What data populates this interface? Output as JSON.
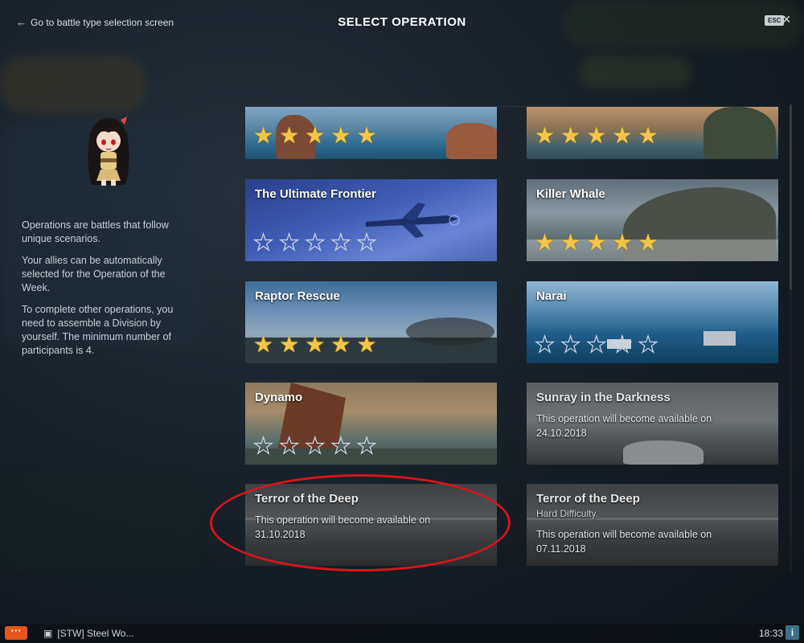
{
  "header": {
    "back_label": "Go to battle type selection screen",
    "title": "SELECT OPERATION",
    "esc_label": "ESC",
    "close_glyph": "×"
  },
  "sidebar": {
    "paragraphs": [
      "Operations are battles that follow unique scenarios.",
      "Your allies can be automatically selected for the Operation of the Week.",
      "To complete other operations, you need to assemble a Division by yourself. The minimum number of participants is 4."
    ]
  },
  "operations": [
    {
      "title": "",
      "stars_earned": 5,
      "stars_total": 5,
      "available": true
    },
    {
      "title": "",
      "stars_earned": 5,
      "stars_total": 5,
      "available": true
    },
    {
      "title": "The Ultimate Frontier",
      "stars_earned": 0,
      "stars_total": 5,
      "available": true
    },
    {
      "title": "Killer Whale",
      "stars_earned": 5,
      "stars_total": 5,
      "available": true
    },
    {
      "title": "Raptor Rescue",
      "stars_earned": 5,
      "stars_total": 5,
      "available": true
    },
    {
      "title": "Narai",
      "stars_earned": 0,
      "stars_total": 5,
      "available": true
    },
    {
      "title": "Dynamo",
      "stars_earned": 0,
      "stars_total": 5,
      "available": true
    },
    {
      "title": "Sunray in the Darkness",
      "available": false,
      "availability_text": "This operation will become available on",
      "availability_date": "24.10.2018"
    },
    {
      "title": "Terror of the Deep",
      "available": false,
      "availability_text": "This operation will become available on",
      "availability_date": "31.10.2018"
    },
    {
      "title": "Terror of the Deep",
      "subtitle": "Hard Difficulty.",
      "available": false,
      "availability_text": "This operation will become available on",
      "availability_date": "07.11.2018"
    }
  ],
  "taskbar": {
    "menu_glyph": "···",
    "chat_label": "[STW] Steel Wo...",
    "clock": "18:33",
    "info_glyph": "i"
  },
  "colors": {
    "star_gold": "#f3c646",
    "highlight": "#d6141c",
    "menu_button": "#e6551a"
  }
}
